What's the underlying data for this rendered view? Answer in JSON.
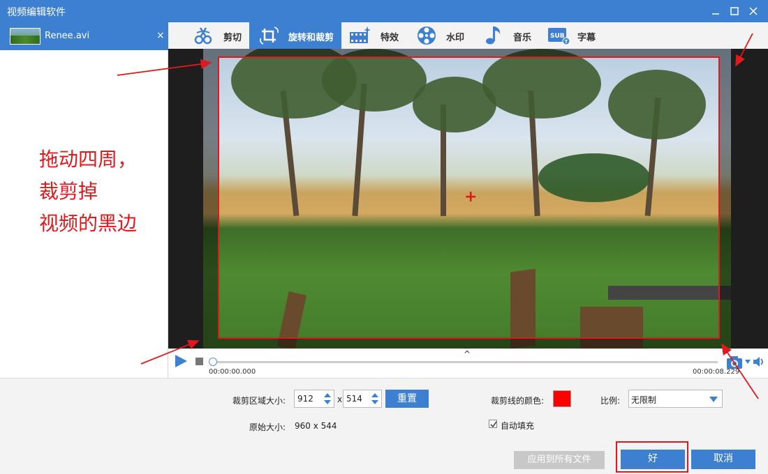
{
  "window": {
    "title": "视频编辑软件"
  },
  "file_list": {
    "items": [
      {
        "name": "Renee.avi",
        "close": "×"
      }
    ]
  },
  "annotation": {
    "lines": [
      "拖动四周，",
      "裁剪掉",
      "视频的黑边"
    ]
  },
  "tabs": [
    {
      "label": "剪切",
      "icon": "scissors-icon",
      "active": false
    },
    {
      "label": "旋转和裁剪",
      "icon": "crop-rotate-icon",
      "active": true
    },
    {
      "label": "特效",
      "icon": "effects-film-icon",
      "active": false
    },
    {
      "label": "水印",
      "icon": "watermark-reel-icon",
      "active": false
    },
    {
      "label": "音乐",
      "icon": "music-note-icon",
      "active": false
    },
    {
      "label": "字幕",
      "icon": "subtitle-icon",
      "active": false
    }
  ],
  "player": {
    "time_current": "00:00:00.000",
    "time_total": "00:00:08.229",
    "progress": 0.0,
    "collapse_glyph": "^"
  },
  "crop": {
    "size_label": "裁剪区域大小:",
    "width": "912",
    "separator": "x",
    "height": "514",
    "reset_label": "重置",
    "original_label": "原始大小:",
    "original_value": "960 x 544",
    "line_color_label": "裁剪线的颜色:",
    "line_color": "#ff0000",
    "ratio_label": "比例:",
    "ratio_value": "无限制",
    "autofill_label": "自动填充",
    "autofill_checked": true
  },
  "buttons": {
    "apply_all": "应用到所有文件",
    "ok": "好",
    "cancel": "取消"
  },
  "colors": {
    "accent": "#3d7fd0",
    "annotation": "#e0191c"
  }
}
